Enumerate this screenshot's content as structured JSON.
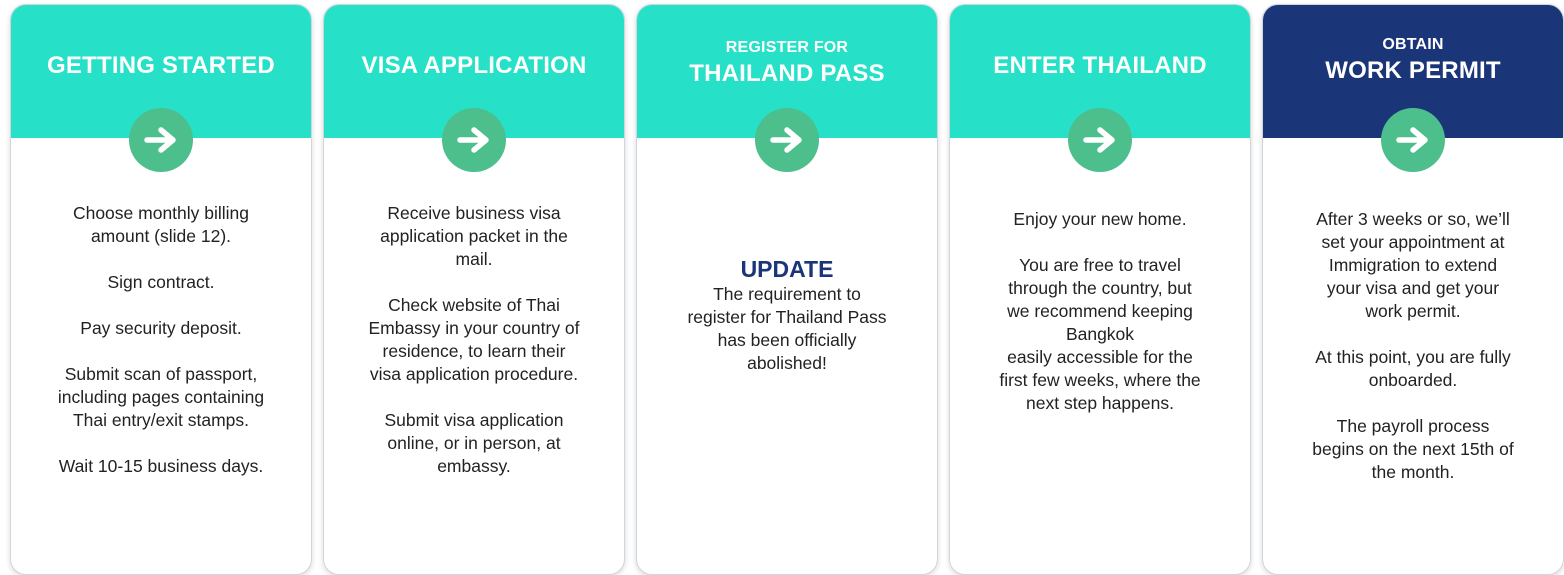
{
  "colors": {
    "teal_header": "#26e1c8",
    "navy_header": "#1a3578",
    "arrow_circle": "#4cbf8d",
    "update_title": "#1a3578"
  },
  "cards": [
    {
      "title": "GETTING STARTED",
      "icon": "arrow-right-icon",
      "paragraphs": [
        [
          "Choose monthly billing",
          "amount (slide 12)."
        ],
        [
          "Sign contract."
        ],
        [
          "Pay security deposit."
        ],
        [
          "Submit scan of passport,",
          "including pages containing",
          "Thai entry/exit stamps."
        ],
        [
          "Wait 10-15 business days."
        ]
      ]
    },
    {
      "title": "VISA APPLICATION",
      "icon": "arrow-right-icon",
      "paragraphs": [
        [
          "Receive business visa",
          "application packet in the",
          "mail."
        ],
        [
          "Check website of Thai",
          "Embassy in your country of",
          "residence, to learn their",
          "visa application procedure."
        ],
        [
          "Submit visa application",
          "online, or in person, at",
          "embassy."
        ]
      ]
    },
    {
      "title_small": "REGISTER FOR",
      "title": "THAILAND PASS",
      "icon": "arrow-right-icon",
      "update_title": "UPDATE",
      "paragraphs": [
        [
          "The requirement to",
          "register for Thailand Pass",
          "has been officially",
          "abolished!"
        ]
      ]
    },
    {
      "title": "ENTER THAILAND",
      "icon": "arrow-right-icon",
      "paragraphs": [
        [
          "Enjoy your new home."
        ],
        [
          "You are free to travel",
          "through the country, but",
          "we recommend keeping",
          "Bangkok",
          "easily accessible for the",
          "first few weeks, where the",
          "next step happens."
        ]
      ]
    },
    {
      "title_small": "OBTAIN",
      "title": "WORK PERMIT",
      "icon": "arrow-right-icon",
      "paragraphs": [
        [
          "After 3 weeks or so, we’ll",
          "set your appointment at",
          "Immigration to extend",
          "your visa and get your",
          "work permit."
        ],
        [
          "At this point, you are fully",
          "onboarded."
        ],
        [
          "The payroll process",
          "begins on the next 15th of",
          "the month."
        ]
      ]
    }
  ]
}
